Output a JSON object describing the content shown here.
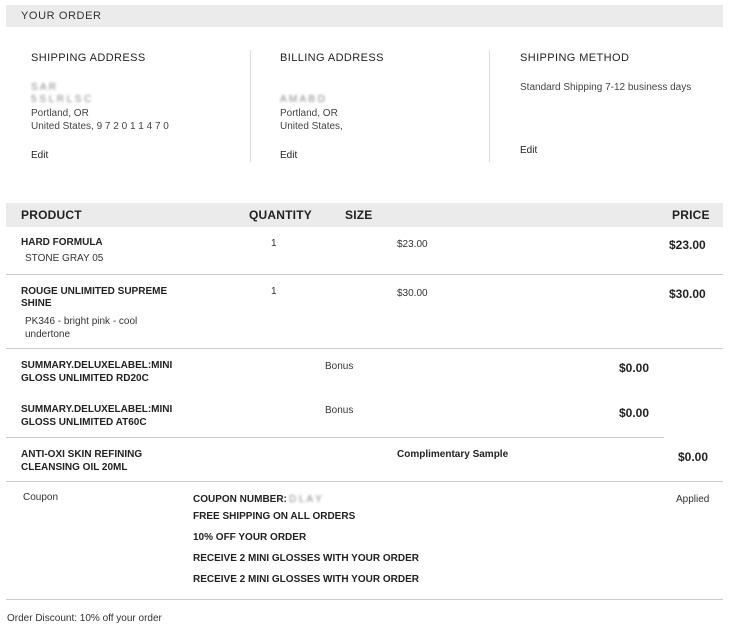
{
  "header": {
    "title": "YOUR ORDER"
  },
  "shipping_address": {
    "heading": "SHIPPING ADDRESS",
    "line1": "S      A  R",
    "line2": "  5  S     L  R  L  S  C",
    "line3": "Portland, OR",
    "line4": "United States, 9 7 2 0 1  1 4 7 0",
    "edit_label": "Edit"
  },
  "billing_address": {
    "heading": "BILLING ADDRESS",
    "line1": "  A      M     A     B  D",
    "line2": "Portland, OR",
    "line3": "United States,",
    "edit_label": "Edit"
  },
  "shipping_method": {
    "heading": "SHIPPING METHOD",
    "value": "Standard Shipping 7-12 business days",
    "edit_label": "Edit"
  },
  "table": {
    "headers": {
      "product": "PRODUCT",
      "quantity": "QUANTITY",
      "size": "SIZE",
      "price": "PRICE"
    },
    "rows": [
      {
        "name": "HARD FORMULA",
        "variant": "STONE GRAY 05",
        "quantity": "1",
        "unit": "$23.00",
        "price": "$23.00"
      },
      {
        "name_l1": "ROUGE UNLIMITED SUPREME",
        "name_l2": "SHINE",
        "variant_l1": "PK346 - bright pink - cool",
        "variant_l2": "undertone",
        "quantity": "1",
        "unit": "$30.00",
        "price": "$30.00"
      }
    ],
    "bonus": [
      {
        "name_l1": "SUMMARY.DELUXELABEL:MINI",
        "name_l2": "GLOSS UNLIMITED RD20C",
        "label": "Bonus",
        "price": "$0.00"
      },
      {
        "name_l1": "SUMMARY.DELUXELABEL:MINI",
        "name_l2": "GLOSS UNLIMITED AT60C",
        "label": "Bonus",
        "price": "$0.00"
      }
    ],
    "sample": {
      "name_l1": "ANTI-OXI SKIN REFINING",
      "name_l2": "CLEANSING OIL 20ML",
      "label": "Complimentary Sample",
      "price": "$0.00"
    }
  },
  "coupon": {
    "label": "Coupon",
    "number_label": "COUPON NUMBER:",
    "number_value": "D L    A   Y",
    "offers": [
      "FREE SHIPPING ON ALL ORDERS",
      "10% OFF YOUR ORDER",
      "RECEIVE 2 MINI GLOSSES WITH YOUR ORDER",
      "RECEIVE 2 MINI GLOSSES WITH YOUR ORDER"
    ],
    "status": "Applied"
  },
  "order_discount": "Order Discount: 10% off your order"
}
